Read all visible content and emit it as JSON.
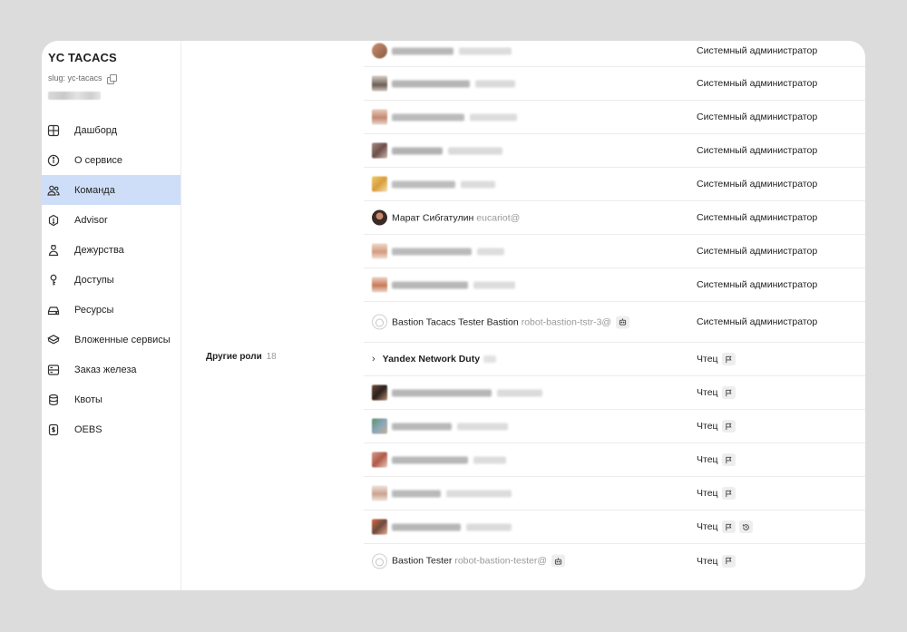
{
  "sidebar": {
    "title": "YC TACACS",
    "slug_text": "slug: yc-tacacs",
    "items": [
      {
        "label": "Дашборд",
        "icon": "dashboard-icon"
      },
      {
        "label": "О сервисе",
        "icon": "info-icon"
      },
      {
        "label": "Команда",
        "icon": "team-icon",
        "active": true
      },
      {
        "label": "Advisor",
        "icon": "advisor-icon"
      },
      {
        "label": "Дежурства",
        "icon": "duty-icon"
      },
      {
        "label": "Доступы",
        "icon": "key-icon"
      },
      {
        "label": "Ресурсы",
        "icon": "resources-icon"
      },
      {
        "label": "Вложенные сервисы",
        "icon": "nested-services-icon"
      },
      {
        "label": "Заказ железа",
        "icon": "hardware-order-icon"
      },
      {
        "label": "Квоты",
        "icon": "quotas-icon"
      },
      {
        "label": "OEBS",
        "icon": "oebs-icon"
      }
    ]
  },
  "admins": {
    "role": "Системный администратор",
    "named_member": {
      "name": "Марат Сибгатулин",
      "login": "eucariot@"
    },
    "robot_member": {
      "name": "Bastion Tacacs Tester Bastion",
      "login": "robot-bastion-tstr-3@"
    }
  },
  "other_roles": {
    "label": "Другие роли",
    "count": "18",
    "group": {
      "name": "Yandex Network Duty",
      "role": "Чтец"
    },
    "reader_role": "Чтец",
    "robot_member": {
      "name": "Bastion Tester",
      "login": "robot-bastion-tester@",
      "role": "Чтец"
    }
  }
}
